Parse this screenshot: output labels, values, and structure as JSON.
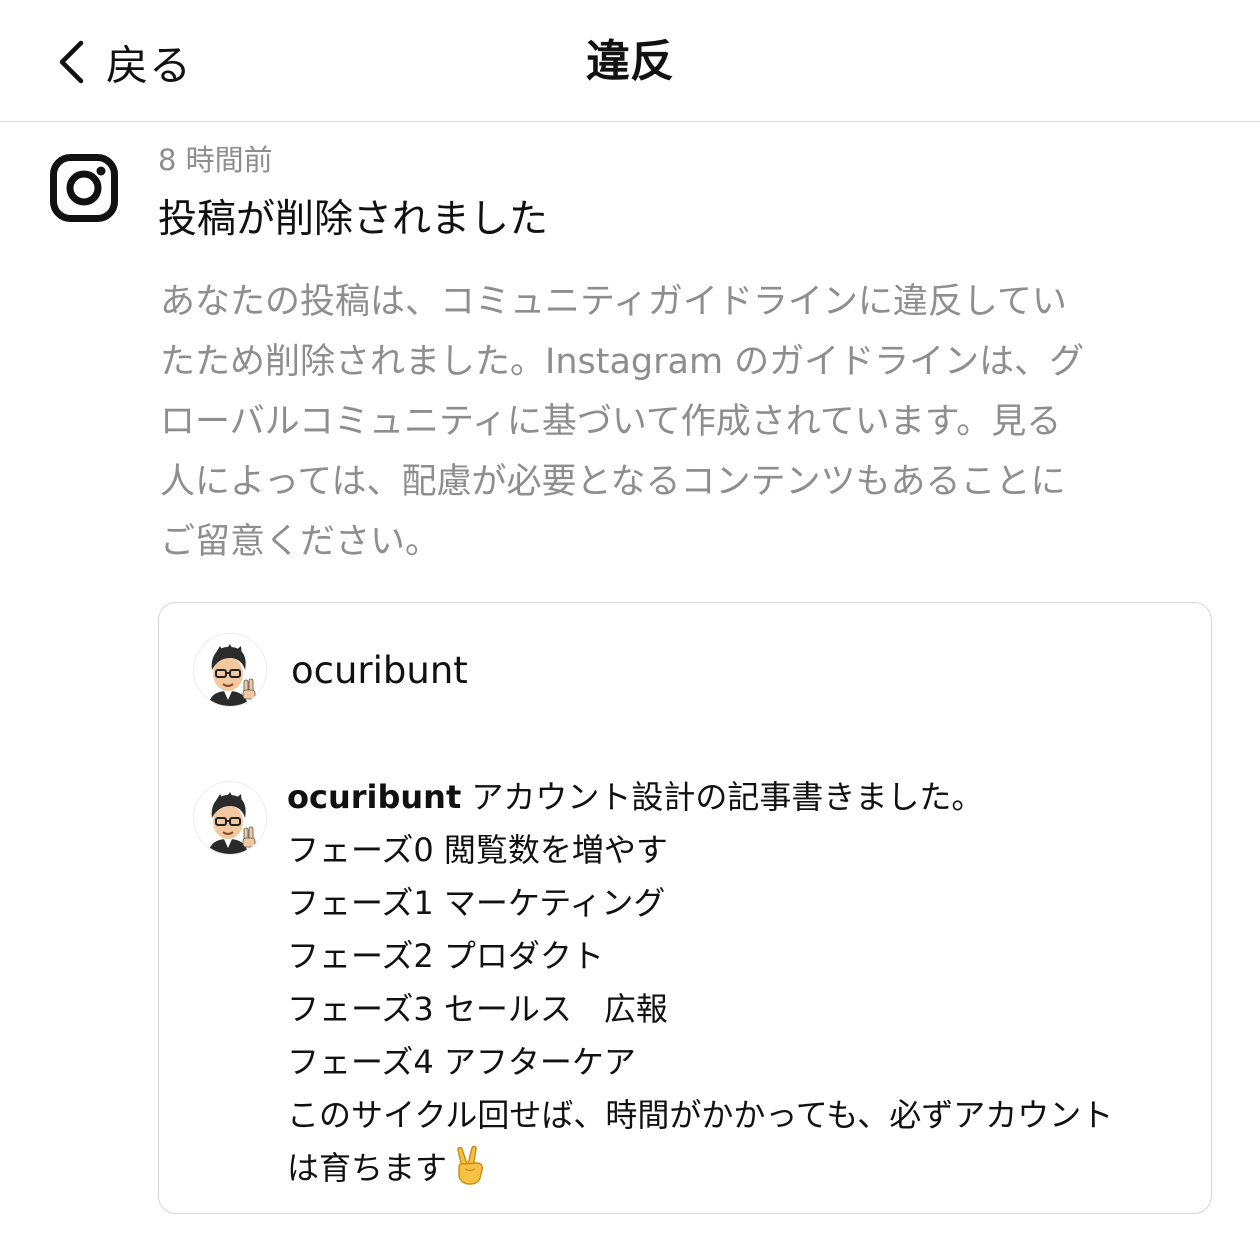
{
  "header": {
    "back_label": "戻る",
    "title": "違反"
  },
  "notification": {
    "icon": "instagram-icon",
    "time": "8 時間前",
    "title": "投稿が削除されました",
    "body_lines": [
      "あなたの投稿は、コミュニティガイドラインに違反してい",
      "たため削除されました。Instagram のガイドラインは、グ",
      "ローバルコミュニティに基づいて作成されています。見る",
      "人によっては、配慮が必要となるコンテンツもあることに",
      "ご留意ください。"
    ]
  },
  "post": {
    "username": "ocuribunt",
    "caption": {
      "username": "ocuribunt",
      "first_line": "アカウント設計の記事書きました。",
      "lines": [
        "フェーズ0 閲覧数を増やす",
        "フェーズ1 マーケティング",
        "フェーズ2 プロダクト",
        "フェーズ3 セールス　広報",
        "フェーズ4 アフターケア",
        "このサイクル回せば、時間がかかっても、必ずアカウント"
      ],
      "last_line": "は育ちます",
      "last_emoji": "victory-hand-emoji"
    }
  }
}
